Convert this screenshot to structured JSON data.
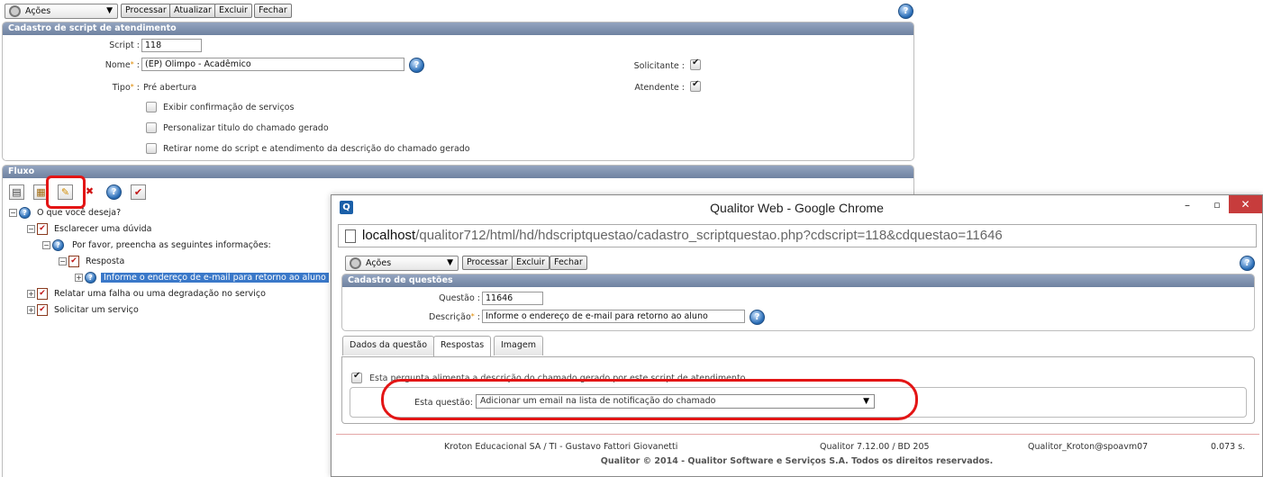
{
  "main": {
    "toolbar": {
      "acoes_label": "Ações",
      "processar": "Processar",
      "atualizar": "Atualizar",
      "excluir": "Excluir",
      "fechar": "Fechar"
    },
    "cadastro": {
      "title": "Cadastro de script de atendimento",
      "script_label": "Script :",
      "script_value": "118",
      "nome_label": "Nome",
      "nome_value": "(EP) Olimpo - Acadêmico",
      "tipo_label": "Tipo",
      "tipo_value": "Pré abertura",
      "solicitante_label": "Solicitante :",
      "atendente_label": "Atendente :",
      "opt1": "Exibir confirmação de serviços",
      "opt2": "Personalizar titulo do chamado gerado",
      "opt3": "Retirar nome do script e atendimento da descrição do chamado gerado"
    },
    "fluxo": {
      "title": "Fluxo",
      "tree": {
        "root": "O que você deseja?",
        "n1": "Esclarecer uma dúvida",
        "n1a": "Por favor, preencha as seguintes informações:",
        "n1a1": "Resposta",
        "n1a1a": "Informe o endereço de e-mail para retorno ao aluno",
        "n2": "Relatar uma falha ou uma degradação no serviço",
        "n3": "Solicitar um serviço"
      }
    }
  },
  "popup": {
    "window_title": "Qualitor Web - Google Chrome",
    "url_host": "localhost",
    "url_path": "/qualitor712/html/hd/hdscriptquestao/cadastro_scriptquestao.php?cdscript=118&cdquestao=11646",
    "toolbar": {
      "acoes_label": "Ações",
      "processar": "Processar",
      "excluir": "Excluir",
      "fechar": "Fechar"
    },
    "cadastro": {
      "title": "Cadastro de questões",
      "questao_label": "Questão :",
      "questao_value": "11646",
      "descricao_label": "Descrição",
      "descricao_value": "Informe o endereço de e-mail para retorno ao aluno"
    },
    "tabs": [
      "Dados da questão",
      "Respostas",
      "Imagem"
    ],
    "checkbox_text": "Esta pergunta alimenta a descrição do chamado gerado por este script de atendimento",
    "esta_questao_label": "Esta questão:",
    "esta_questao_value": "Adicionar um email na lista de notificação do chamado",
    "footer": {
      "company": "Kroton Educacional SA / TI - Gustavo Fattori Giovanetti",
      "version": "Qualitor 7.12.00 / BD 205",
      "user": "Qualitor_Kroton@spoavm07",
      "time": "0.073 s.",
      "copyright": "Qualitor © 2014 - Qualitor Software e Serviços S.A. Todos os direitos reservados."
    }
  },
  "colors": {
    "annotation": "#e31515",
    "header": "#7c8eab",
    "selection": "#3a78c9"
  }
}
